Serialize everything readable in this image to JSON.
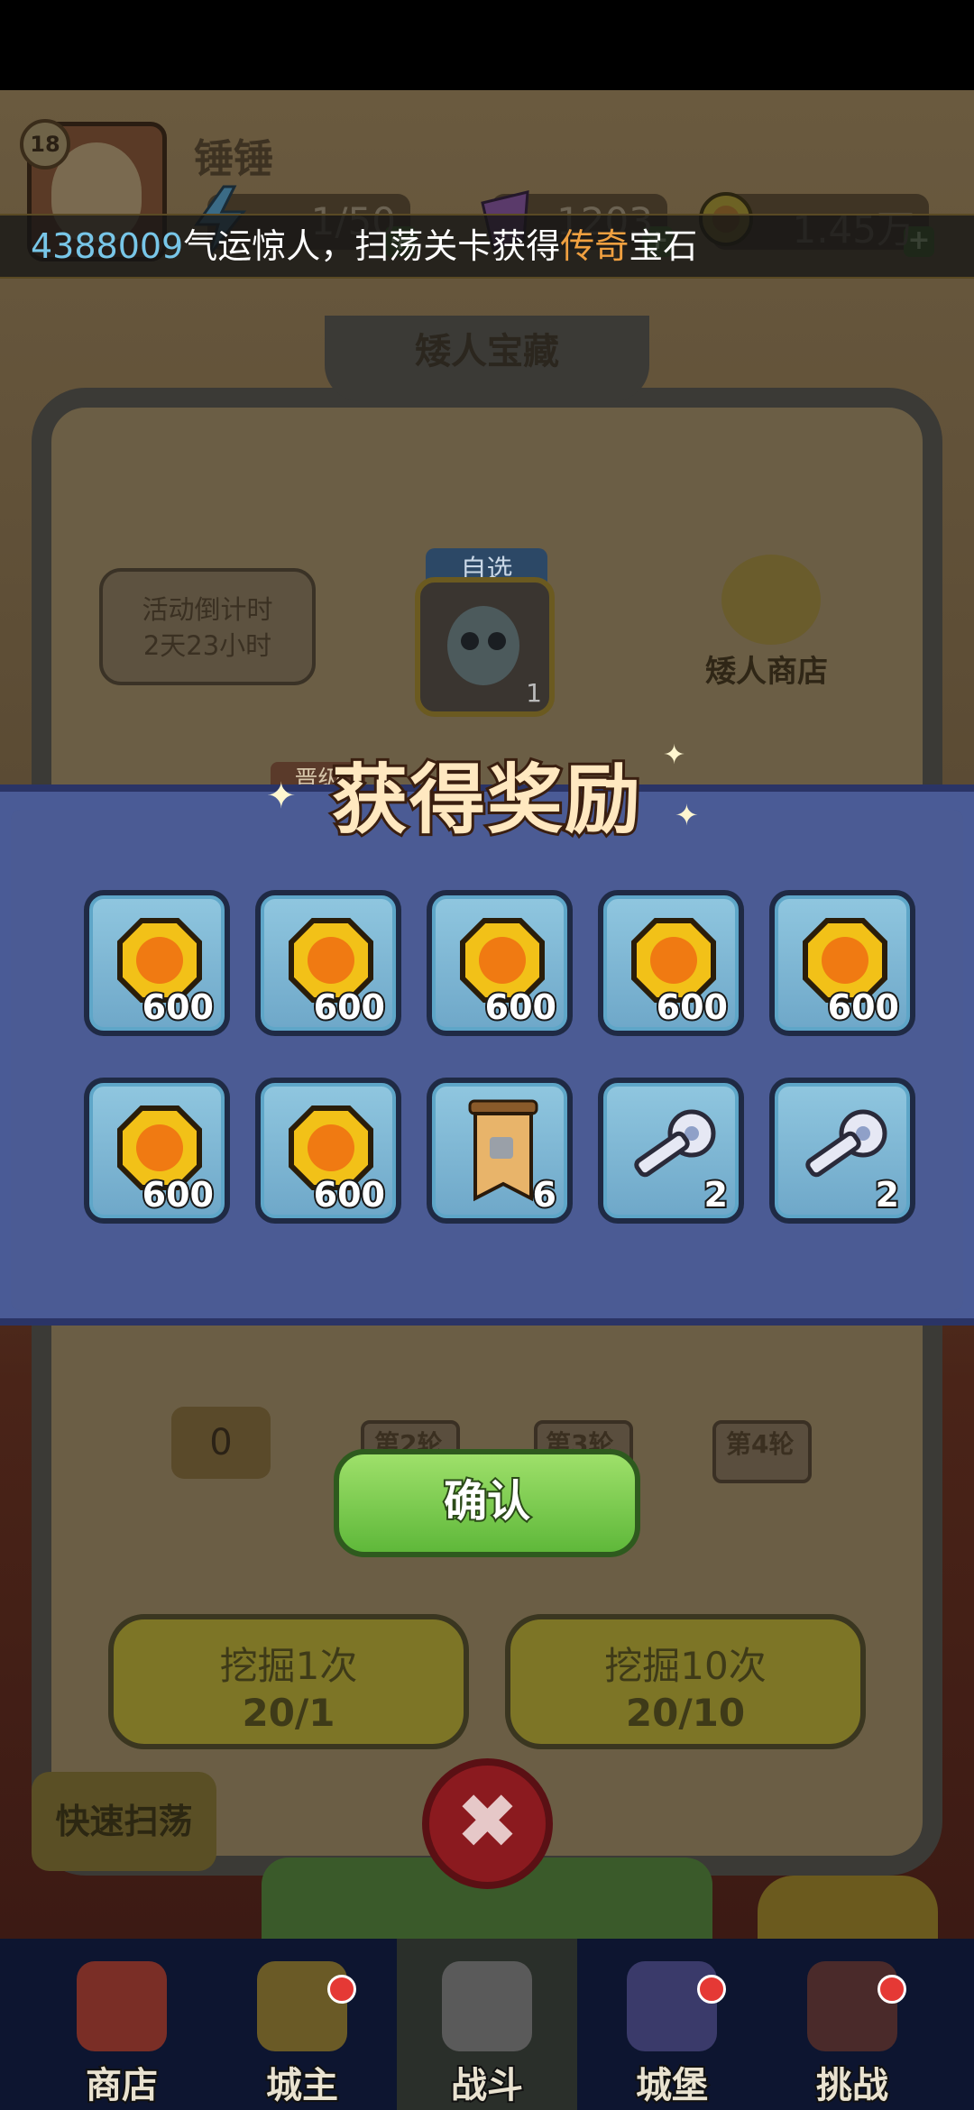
{
  "player": {
    "level": "18",
    "name": "锤锤"
  },
  "resources": [
    {
      "name": "energy",
      "value": "1/50",
      "icon": "lightning-icon"
    },
    {
      "name": "gems",
      "value": "1203",
      "icon": "gem-icon"
    },
    {
      "name": "gold",
      "value": "1.45万",
      "icon": "coin-icon"
    }
  ],
  "ticker": {
    "player_id": "4388009",
    "text_before": "气运惊人，扫荡关卡获得",
    "highlight": "传奇",
    "text_after": "宝石"
  },
  "event": {
    "title": "矮人宝藏",
    "countdown_label": "活动倒计时",
    "countdown_value": "2天23小时",
    "select_tag": "自选",
    "boss_count": "1",
    "shop_label": "矮人商店",
    "promote_tag": "晋级",
    "first_round_value": "0",
    "rounds": [
      "第2轮",
      "第3轮",
      "第4轮"
    ],
    "dig_once_label": "挖掘1次",
    "dig_once_cost": "20/1",
    "dig_ten_label": "挖掘10次",
    "dig_ten_cost": "20/10",
    "quick_sweep": "快速扫荡"
  },
  "modal": {
    "title": "获得奖励",
    "rewards": [
      {
        "type": "coin",
        "count": "600"
      },
      {
        "type": "coin",
        "count": "600"
      },
      {
        "type": "coin",
        "count": "600"
      },
      {
        "type": "coin",
        "count": "600"
      },
      {
        "type": "coin",
        "count": "600"
      },
      {
        "type": "coin",
        "count": "600"
      },
      {
        "type": "coin",
        "count": "600"
      },
      {
        "type": "scroll",
        "count": "6"
      },
      {
        "type": "key",
        "count": "2"
      },
      {
        "type": "key",
        "count": "2"
      }
    ],
    "confirm_label": "确认",
    "close_symbol": "✖"
  },
  "nav": [
    {
      "label": "商店",
      "icon": "shop-icon",
      "dot": false
    },
    {
      "label": "城主",
      "icon": "crown-icon",
      "dot": true
    },
    {
      "label": "战斗",
      "icon": "crossed-swords-icon",
      "dot": false,
      "active": true
    },
    {
      "label": "城堡",
      "icon": "castle-icon",
      "dot": true
    },
    {
      "label": "挑战",
      "icon": "demon-icon",
      "dot": true
    }
  ],
  "colors": {
    "modal_bg": "#4a5b96",
    "confirm_green": "#5fb83a",
    "ticker_id": "#78c6e8",
    "ticker_highlight": "#f0a040"
  }
}
